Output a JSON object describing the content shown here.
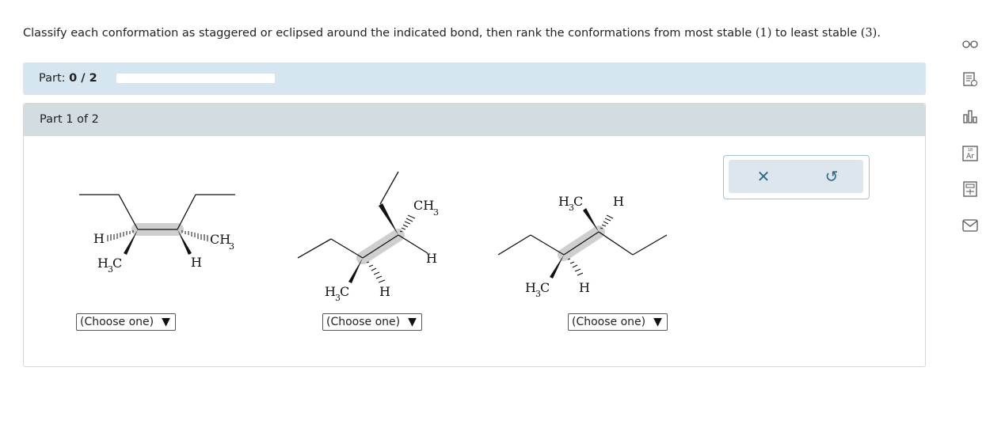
{
  "question": {
    "text_before": "Classify each conformation as staggered or eclipsed around the indicated bond, then rank the conformations from most stable ",
    "num1": "(1)",
    "text_mid": " to least stable ",
    "num2": "(3)",
    "text_after": "."
  },
  "part_bar": {
    "label": "Part:",
    "value": "0 / 2",
    "progress": 0
  },
  "panel": {
    "header": "Part 1 of 2"
  },
  "molecules": [
    {
      "labels": {
        "left_h": "H",
        "left_ch3_main": "H",
        "left_ch3_sub": "3",
        "left_ch3_c": "C",
        "right_ch": "CH",
        "right_sub": "3",
        "right_h": "H"
      },
      "dropdown": "(Choose one)"
    },
    {
      "labels": {
        "top_ch": "CH",
        "top_sub": "3",
        "right_h": "H",
        "bottom_h3c_h": "H",
        "bottom_h3c_sub": "3",
        "bottom_h3c_c": "C",
        "bottom_h": "H"
      },
      "dropdown": "(Choose one)"
    },
    {
      "labels": {
        "top_h3c_h": "H",
        "top_h3c_sub": "3",
        "top_h3c_c": "C",
        "top_h": "H",
        "bottom_h3c_h": "H",
        "bottom_h3c_sub": "3",
        "bottom_h3c_c": "C",
        "bottom_h": "H"
      },
      "dropdown": "(Choose one)"
    }
  ],
  "dropdown_arrow": "▼",
  "actions": {
    "clear": "✕",
    "undo": "↺"
  },
  "colors": {
    "part_bar_bg": "#d6e6f0",
    "panel_header_bg": "#d2dce1",
    "action_accent": "#2a6d8a"
  },
  "side_tools": [
    "glasses-icon",
    "checklist-icon",
    "bar-chart-icon",
    "periodic-table-icon",
    "calculator-icon",
    "mail-icon"
  ],
  "periodic_tile": {
    "number": "18",
    "symbol": "Ar"
  }
}
